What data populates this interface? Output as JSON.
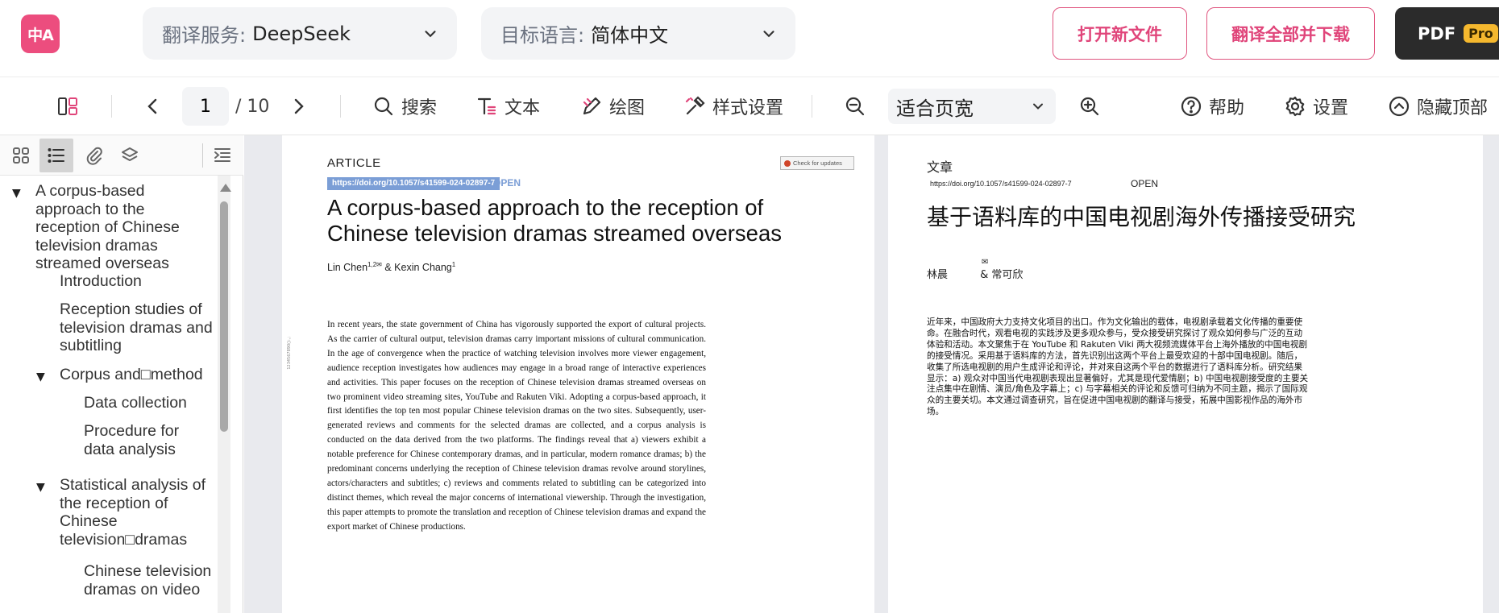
{
  "header": {
    "logo_text": "中A",
    "translation_service": {
      "label": "翻译服务:",
      "value": "DeepSeek"
    },
    "target_language": {
      "label": "目标语言:",
      "value": "简体中文"
    },
    "open_new_file": "打开新文件",
    "translate_all_download": "翻译全部并下载",
    "pdf_pro": {
      "label": "PDF",
      "badge": "Pro"
    },
    "accent_color": "#e0457a"
  },
  "toolbar": {
    "page_current": "1",
    "page_total": "/ 10",
    "search": "搜索",
    "text": "文本",
    "draw": "绘图",
    "style_settings": "样式设置",
    "zoom_value": "适合页宽",
    "help": "帮助",
    "settings": "设置",
    "hide_top": "隐藏顶部"
  },
  "sidebar": {
    "outline": [
      {
        "text": "A corpus-based approach to the reception of Chinese television dramas streamed overseas",
        "level": 0,
        "expanded": true
      },
      {
        "text": "Introduction",
        "level": 1
      },
      {
        "text": "Reception studies of television dramas and subtitling",
        "level": 1
      },
      {
        "text": "Corpus and□method",
        "level": 1,
        "expanded": true
      },
      {
        "text": "Data collection",
        "level": 2
      },
      {
        "text": "Procedure for data analysis",
        "level": 2
      },
      {
        "text": "Statistical analysis of the reception of Chinese television□dramas",
        "level": 1,
        "expanded": true
      },
      {
        "text": "Chinese television dramas on video",
        "level": 2
      }
    ]
  },
  "document": {
    "original": {
      "article_label": "ARTICLE",
      "doi": "https://doi.org/10.1057/s41599-024-02897-7",
      "open_label": "OPEN",
      "check_updates": "Check for updates",
      "title": "A corpus-based approach to the reception of Chinese television dramas streamed overseas",
      "author_1": "Lin Chen",
      "author_1_sup": "1,2✉",
      "author_sep": "& Kexin Chang",
      "author_2_sup": "1",
      "side_note": "1234567890():,;",
      "abstract": "In recent years, the state government of China has vigorously supported the export of cultural projects. As the carrier of cultural output, television dramas carry important missions of cultural communication. In the age of convergence when the practice of watching television involves more viewer engagement, audience reception investigates how audiences may engage in a broad range of interactive experiences and activities. This paper focuses on the reception of Chinese television dramas streamed overseas on two prominent video streaming sites, YouTube and Rakuten Viki. Adopting a corpus-based approach, it first identifies the top ten most popular Chinese television dramas on the two sites. Subsequently, user-generated reviews and comments for the selected dramas are collected, and a corpus analysis is conducted on the data derived from the two platforms. The findings reveal that a) viewers exhibit a notable preference for Chinese contemporary dramas, and in particular, modern romance dramas; b) the predominant concerns underlying the reception of Chinese television dramas revolve around storylines, actors/characters and subtitles; c) reviews and comments related to subtitling can be categorized into distinct themes, which reveal the major concerns of international viewership. Through the investigation, this paper attempts to promote the translation and reception of Chinese television dramas and expand the export market of Chinese productions."
    },
    "translated": {
      "article_label": "文章",
      "doi": "https://doi.org/10.1057/s41599-024-02897-7",
      "open_label": "OPEN",
      "title": "基于语料库的中国电视剧海外传播接受研究",
      "author_1": "林晨",
      "mail": "✉",
      "author_2": "& 常可欣",
      "abstract": "近年来，中国政府大力支持文化项目的出口。作为文化输出的载体，电视剧承载着文化传播的重要使命。在融合时代，观看电视的实践涉及更多观众参与，受众接受研究探讨了观众如何参与广泛的互动体验和活动。本文聚焦于在 YouTube 和 Rakuten Viki 两大视频流媒体平台上海外播放的中国电视剧的接受情况。采用基于语料库的方法，首先识别出这两个平台上最受欢迎的十部中国电视剧。随后，收集了所选电视剧的用户生成评论和评论，并对来自这两个平台的数据进行了语料库分析。研究结果显示：a) 观众对中国当代电视剧表现出显著偏好，尤其是现代爱情剧；b) 中国电视剧接受度的主要关注点集中在剧情、演员/角色及字幕上；c) 与字幕相关的评论和反馈可归纳为不同主题，揭示了国际观众的主要关切。本文通过调查研究，旨在促进中国电视剧的翻译与接受，拓展中国影视作品的海外市场。"
    }
  }
}
